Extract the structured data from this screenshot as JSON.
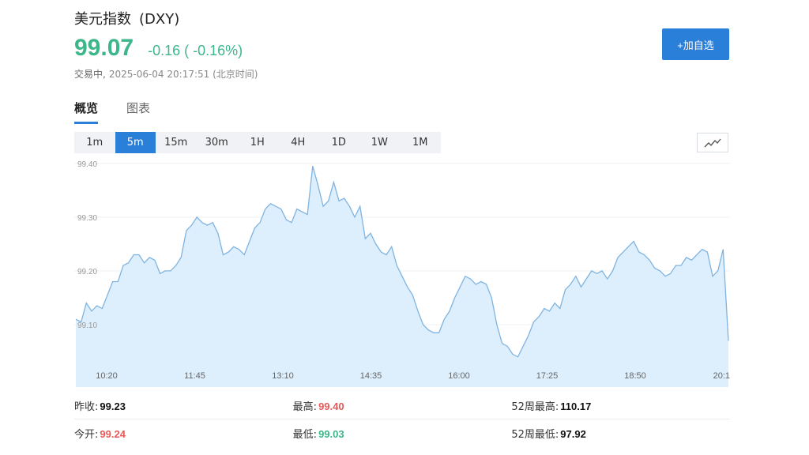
{
  "header": {
    "name": "美元指数",
    "code": "(DXY)",
    "price": "99.07",
    "change": "-0.16 ( -0.16%)",
    "status": "交易中,",
    "timestamp": "2025-06-04 20:17:51 (北京时间)",
    "add_button": "+加自选"
  },
  "tabs": [
    "概览",
    "图表"
  ],
  "periods": [
    "1m",
    "5m",
    "15m",
    "30m",
    "1H",
    "4H",
    "1D",
    "1W",
    "1M"
  ],
  "active_period": "5m",
  "colors": {
    "accent": "#2a7fd9",
    "down": "#3cb68a",
    "up": "#e85a5a",
    "area": "#ddeefc",
    "line": "#7fb4e0"
  },
  "chart_data": {
    "type": "area",
    "yticks": [
      "99.40",
      "99.30",
      "99.20",
      "99.10"
    ],
    "ylim": [
      99.025,
      99.41
    ],
    "xticks": [
      "10:20",
      "11:45",
      "13:10",
      "14:35",
      "16:00",
      "17:25",
      "18:50",
      "20:1"
    ],
    "grid": true,
    "values": [
      99.11,
      99.105,
      99.14,
      99.125,
      99.135,
      99.13,
      99.155,
      99.18,
      99.18,
      99.21,
      99.215,
      99.23,
      99.23,
      99.215,
      99.225,
      99.22,
      99.195,
      99.2,
      99.2,
      99.21,
      99.225,
      99.275,
      99.285,
      99.3,
      99.29,
      99.285,
      99.29,
      99.27,
      99.23,
      99.235,
      99.245,
      99.24,
      99.23,
      99.255,
      99.28,
      99.29,
      99.315,
      99.325,
      99.32,
      99.315,
      99.295,
      99.29,
      99.315,
      99.31,
      99.305,
      99.395,
      99.36,
      99.32,
      99.33,
      99.365,
      99.33,
      99.335,
      99.32,
      99.3,
      99.32,
      99.26,
      99.27,
      99.25,
      99.235,
      99.23,
      99.245,
      99.21,
      99.19,
      99.17,
      99.155,
      99.125,
      99.1,
      99.09,
      99.085,
      99.085,
      99.11,
      99.125,
      99.15,
      99.17,
      99.19,
      99.185,
      99.175,
      99.18,
      99.175,
      99.15,
      99.1,
      99.065,
      99.06,
      99.045,
      99.04,
      99.06,
      99.08,
      99.105,
      99.115,
      99.13,
      99.125,
      99.14,
      99.13,
      99.165,
      99.175,
      99.19,
      99.17,
      99.185,
      99.2,
      99.195,
      99.2,
      99.185,
      99.2,
      99.225,
      99.235,
      99.245,
      99.255,
      99.235,
      99.23,
      99.22,
      99.205,
      99.2,
      99.19,
      99.195,
      99.21,
      99.21,
      99.225,
      99.22,
      99.23,
      99.24,
      99.235,
      99.19,
      99.2,
      99.24,
      99.07
    ]
  },
  "stats": [
    [
      {
        "label": "昨收:",
        "value": "99.23",
        "color": "black"
      },
      {
        "label": "最高:",
        "value": "99.40",
        "color": "red"
      },
      {
        "label": "52周最高:",
        "value": "110.17",
        "color": "black"
      }
    ],
    [
      {
        "label": "今开:",
        "value": "99.24",
        "color": "red"
      },
      {
        "label": "最低:",
        "value": "99.03",
        "color": "green"
      },
      {
        "label": "52周最低:",
        "value": "97.92",
        "color": "black"
      }
    ]
  ]
}
